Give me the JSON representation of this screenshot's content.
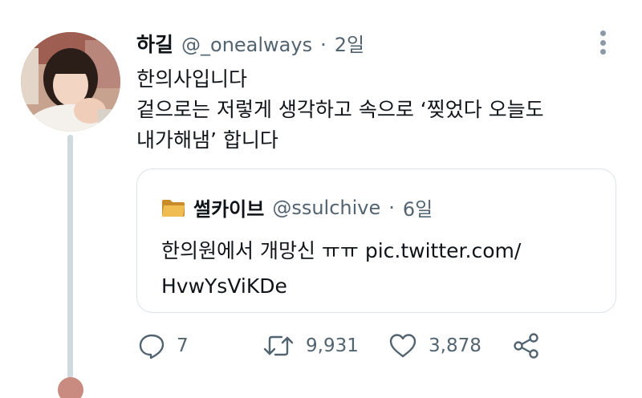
{
  "tweet": {
    "display_name": "하길",
    "handle": "@_onealways",
    "separator": "·",
    "time": "2일",
    "lines": [
      "한의사입니다",
      "겉으로는 저렇게 생각하고 속으로 ‘찢었다 오늘도",
      "내가해냄’ 합니다"
    ],
    "icons": {
      "avatar": "profile-photo",
      "more": "more-vertical-icon"
    }
  },
  "quote": {
    "display_name": "썰카이브",
    "handle": "@ssulchive",
    "separator": "·",
    "time": "6일",
    "lines": [
      "한의원에서 개망신 ㅠㅠ pic.twitter.com/",
      "HvwYsViKDe"
    ],
    "icon": "folder-icon"
  },
  "actions": {
    "reply": {
      "icon": "reply-icon",
      "count": "7"
    },
    "retweet": {
      "icon": "retweet-icon",
      "count": "9,931"
    },
    "like": {
      "icon": "heart-icon",
      "count": "3,878"
    },
    "share": {
      "icon": "share-icon"
    }
  },
  "colors": {
    "text": "#0f1419",
    "secondary": "#536471",
    "border": "#dde3e7",
    "thread_line": "#cfd9de",
    "folder": "#e8b04a"
  }
}
